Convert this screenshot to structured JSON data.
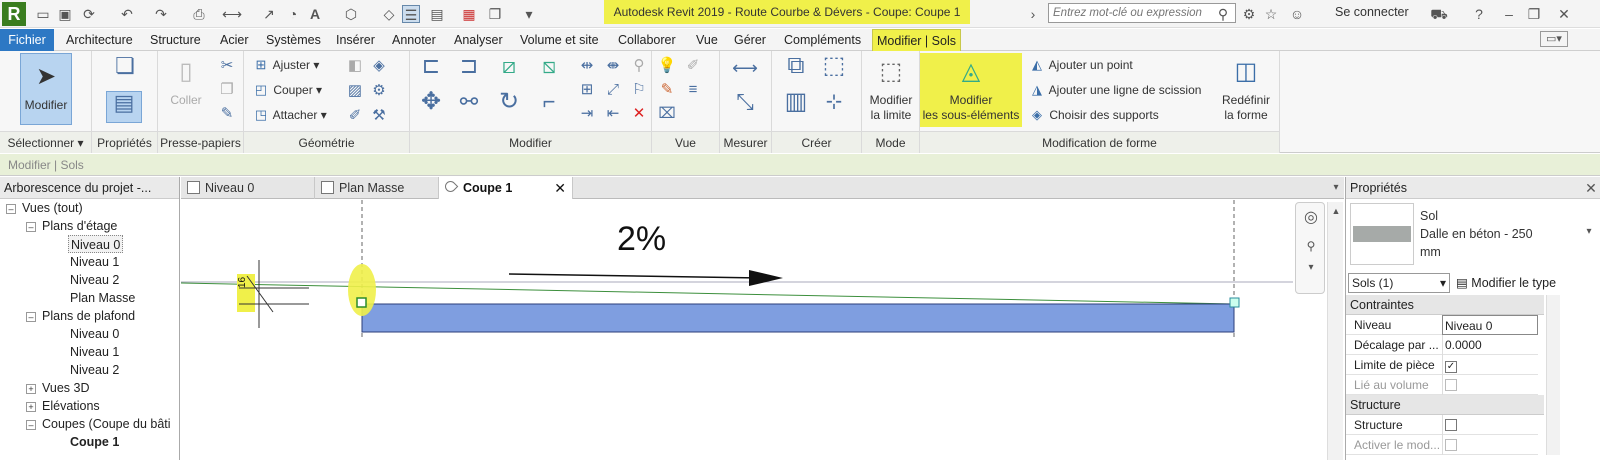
{
  "app": {
    "title": "Autodesk Revit 2019 - Route Courbe & Dévers - Coupe: Coupe 1",
    "logo": "R",
    "search_placeholder": "Entrez mot-clé ou expression",
    "signin": "Se connecter"
  },
  "tabs": [
    "Fichier",
    "Architecture",
    "Structure",
    "Acier",
    "Systèmes",
    "Insérer",
    "Annoter",
    "Analyser",
    "Volume et site",
    "Collaborer",
    "Vue",
    "Gérer",
    "Compléments",
    "Modifier | Sols"
  ],
  "ribbon": {
    "select": {
      "button": "Modifier",
      "title": "Sélectionner ▾"
    },
    "props": {
      "title": "Propriétés"
    },
    "clip": {
      "paste": "Coller",
      "title": "Presse-papiers"
    },
    "geom": {
      "items": [
        "Ajuster",
        "Couper",
        "Attacher"
      ],
      "title": "Géométrie"
    },
    "modify": {
      "title": "Modifier"
    },
    "view": {
      "title": "Vue"
    },
    "measure": {
      "title": "Mesurer"
    },
    "create": {
      "title": "Créer"
    },
    "mode": {
      "button1": "Modifier",
      "button2": "la limite",
      "title": "Mode"
    },
    "shape": {
      "sub1": "Modifier",
      "sub2": "les sous-éléments",
      "items": [
        "Ajouter un point",
        "Ajouter une ligne de scission",
        "Choisir des supports"
      ],
      "redef1": "Redéfinir",
      "redef2": "la forme",
      "title": "Modification de forme"
    }
  },
  "context_bar": "Modifier | Sols",
  "browser": {
    "title": "Arborescence du projet -...",
    "items": [
      "Vues (tout)",
      "Plans d'étage",
      "Niveau 0",
      "Niveau 1",
      "Niveau 2",
      "Plan Masse",
      "Plans de plafond",
      "Niveau 0",
      "Niveau 1",
      "Niveau 2",
      "Vues 3D",
      "Elévations",
      "Coupes (Coupe du bâti",
      "Coupe 1"
    ]
  },
  "view_tabs": [
    "Niveau 0",
    "Plan Masse",
    "Coupe 1"
  ],
  "canvas": {
    "slope_label": "2%",
    "level_tag": "16"
  },
  "properties": {
    "title": "Propriétés",
    "family": "Sol",
    "type_line1": "Dalle en béton - 250",
    "type_line2": "mm",
    "selector": "Sols (1)",
    "edit_type": "Modifier le type",
    "sections": [
      "Contraintes",
      "Structure"
    ],
    "rows": [
      {
        "label": "Niveau",
        "value": "Niveau 0"
      },
      {
        "label": "Décalage par ...",
        "value": "0.0000"
      },
      {
        "label": "Limite de pièce",
        "value": ""
      },
      {
        "label": "Lié au volume",
        "value": ""
      },
      {
        "label": "Structure",
        "value": ""
      },
      {
        "label": "Activer le mod...",
        "value": ""
      }
    ]
  },
  "colors": {
    "highlight": "#f0f04a",
    "floor_fill": "#7f9ee0",
    "accent": "#2d78c4"
  }
}
